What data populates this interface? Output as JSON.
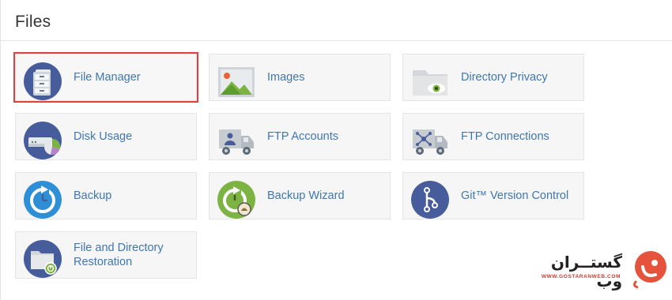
{
  "section": {
    "title": "Files"
  },
  "tiles": [
    {
      "label": "File Manager",
      "icon": "file-manager-icon"
    },
    {
      "label": "Images",
      "icon": "images-icon"
    },
    {
      "label": "Directory Privacy",
      "icon": "directory-privacy-icon"
    },
    {
      "label": "Disk Usage",
      "icon": "disk-usage-icon"
    },
    {
      "label": "FTP Accounts",
      "icon": "ftp-accounts-icon"
    },
    {
      "label": "FTP Connections",
      "icon": "ftp-connections-icon"
    },
    {
      "label": "Backup",
      "icon": "backup-icon"
    },
    {
      "label": "Backup Wizard",
      "icon": "backup-wizard-icon"
    },
    {
      "label": "Git™ Version Control",
      "icon": "git-icon"
    },
    {
      "label": "File and Directory Restoration",
      "icon": "restoration-icon"
    }
  ],
  "selected_tile": "File Manager",
  "watermark": {
    "name": "گستــران وب",
    "url": "WWW.GOSTARANWEB.COM"
  },
  "colors": {
    "link": "#3e77b1",
    "highlight": "#e14040",
    "icon_blue": "#445a9a",
    "icon_green": "#7cb342"
  }
}
